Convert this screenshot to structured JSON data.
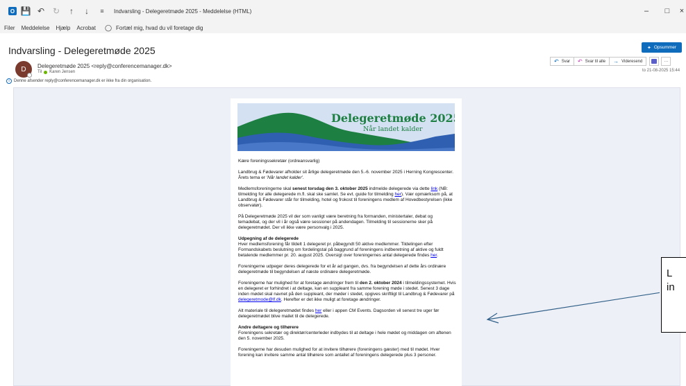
{
  "window": {
    "title": "Indvarsling - Delegeretmøde 2025  -  Meddelelse (HTML)",
    "logo_letter": "O",
    "qat_icons": [
      "save-icon",
      "undo-icon",
      "redo-icon",
      "up-arrow-icon",
      "down-arrow-icon",
      "customize-icon"
    ],
    "minimize": "–",
    "maximize": "□",
    "close": "×"
  },
  "menu": {
    "items": [
      "Filer",
      "Meddelelse",
      "Hjælp",
      "Acrobat"
    ],
    "tellme": "Fortæl mig, hvad du vil foretage dig"
  },
  "message": {
    "subject": "Indvarsling - Delegeretmøde 2025",
    "summarize": "Opsummer",
    "avatar_initial": "D",
    "sender": "Delegeretmøde 2025 <reply@conferencemanager.dk>",
    "to_label": "Til",
    "to_name": "Karen Jensen",
    "warning": "Denne afsender reply@conferencemanager.dk er ikke fra din organisation.",
    "timestamp": "to 21-08-2025 15:44",
    "actions": {
      "reply": "Svar",
      "reply_all": "Svar til alle",
      "forward": "Videresend",
      "more": "···"
    }
  },
  "banner": {
    "title": "Delegeretmøde 2025",
    "subtitle": "Når landet kalder",
    "colors": {
      "sky": "#d3e1f2",
      "green": "#1d7f41",
      "blue": "#2f5fb0"
    }
  },
  "body": {
    "greeting": "Kære foreningssekretær (ordreansvarlig)",
    "p1": "Landbrug & Fødevarer afholder sit årlige delegeretmøde den 5.-6. november 2025 i Herning Kongrescenter. Årets tema er ",
    "p1_theme": "'Når landet kalder'",
    "p1_end": ".",
    "p2_a": "Medlemsforeningerne skal ",
    "p2_bold": "senest torsdag den 3. oktober 2025",
    "p2_b": " indmelde delegerede via dette ",
    "p2_link": "link",
    "p2_c": " (NB: tilmelding for alle delegerede m.fl. skal ske samlet. Se evt. guide for tilmelding ",
    "p2_link2": "her",
    "p2_d": "). Vær opmærksom på, at Landbrug & Fødevarer står for tilmelding, hotel og frokost til foreningens medlem af Hovedbestyrelsen (ikke observatør).",
    "p3": "På Delegeretmøde 2025 vil der som vanligt være beretning fra formanden, ministertaler, debat og temadebat, og der vil i år også være sessioner på andendagen. Tilmelding til sessionerne sker på delegeretmødet. Der vil ikke være personvalg i 2025.",
    "h1": "Udpegning af de delegerede",
    "p4": "Hver medlemsforening får tildelt 1 delegeret pr. påbegyndt 50 aktive medlemmer. Tildelingen efter Formandskabets beslutning om fordelingstal på baggrund af foreningens indberetning af aktive og fuldt betalende medlemmer pr. 20. august 2025. Oversigt over foreningernes antal delegerede findes ",
    "p4_link": "her",
    "p4_end": ".",
    "p5": "Foreningerne udpeger deres delegerede for et år ad gangen, dvs. fra begyndelsen af dette års ordinære delegeretmøde til begyndelsen af næste ordinære delegeretmøde.",
    "p6_a": "Foreningerne har mulighed for at foretage ændringer frem til ",
    "p6_bold": "den 2. oktober 2024",
    "p6_b": " i tilmeldingssystemet.  Hvis en delegeret er forhindret i at deltage, kan en suppleant fra samme forening møde i stedet. Senest 3 dage inden mødet skal navnet på den suppleant, der møder i stedet, opgives skriftligt til Landbrug & Fødevarer på ",
    "p6_link": "delegeretmode@lf.dk",
    "p6_c": ". Herefter er det ikke muligt at foretage ændringer.",
    "p7_a": "Alt materiale til delegeretmødet findes ",
    "p7_link": "her",
    "p7_b": " eller i appen CM Events. Dagsorden vil senest tre uger før delegeretmødet blive mailet til de delegerede.",
    "h2": "Andre deltagere og tilhørere",
    "p8": "Foreningens sekretær og direktør/centerleder indbydes til at deltage i hele mødet og middagen om aftenen den 5. november 2025.",
    "p9": "Foreningerne har desuden mulighed for at invitere tilhørere (foreningens gæster) med til mødet. Hver forening kan invitere samme antal tilhørere som antallet af foreningens delegerede plus 3 personer."
  },
  "callout": {
    "line1": "L",
    "line2": "in"
  }
}
